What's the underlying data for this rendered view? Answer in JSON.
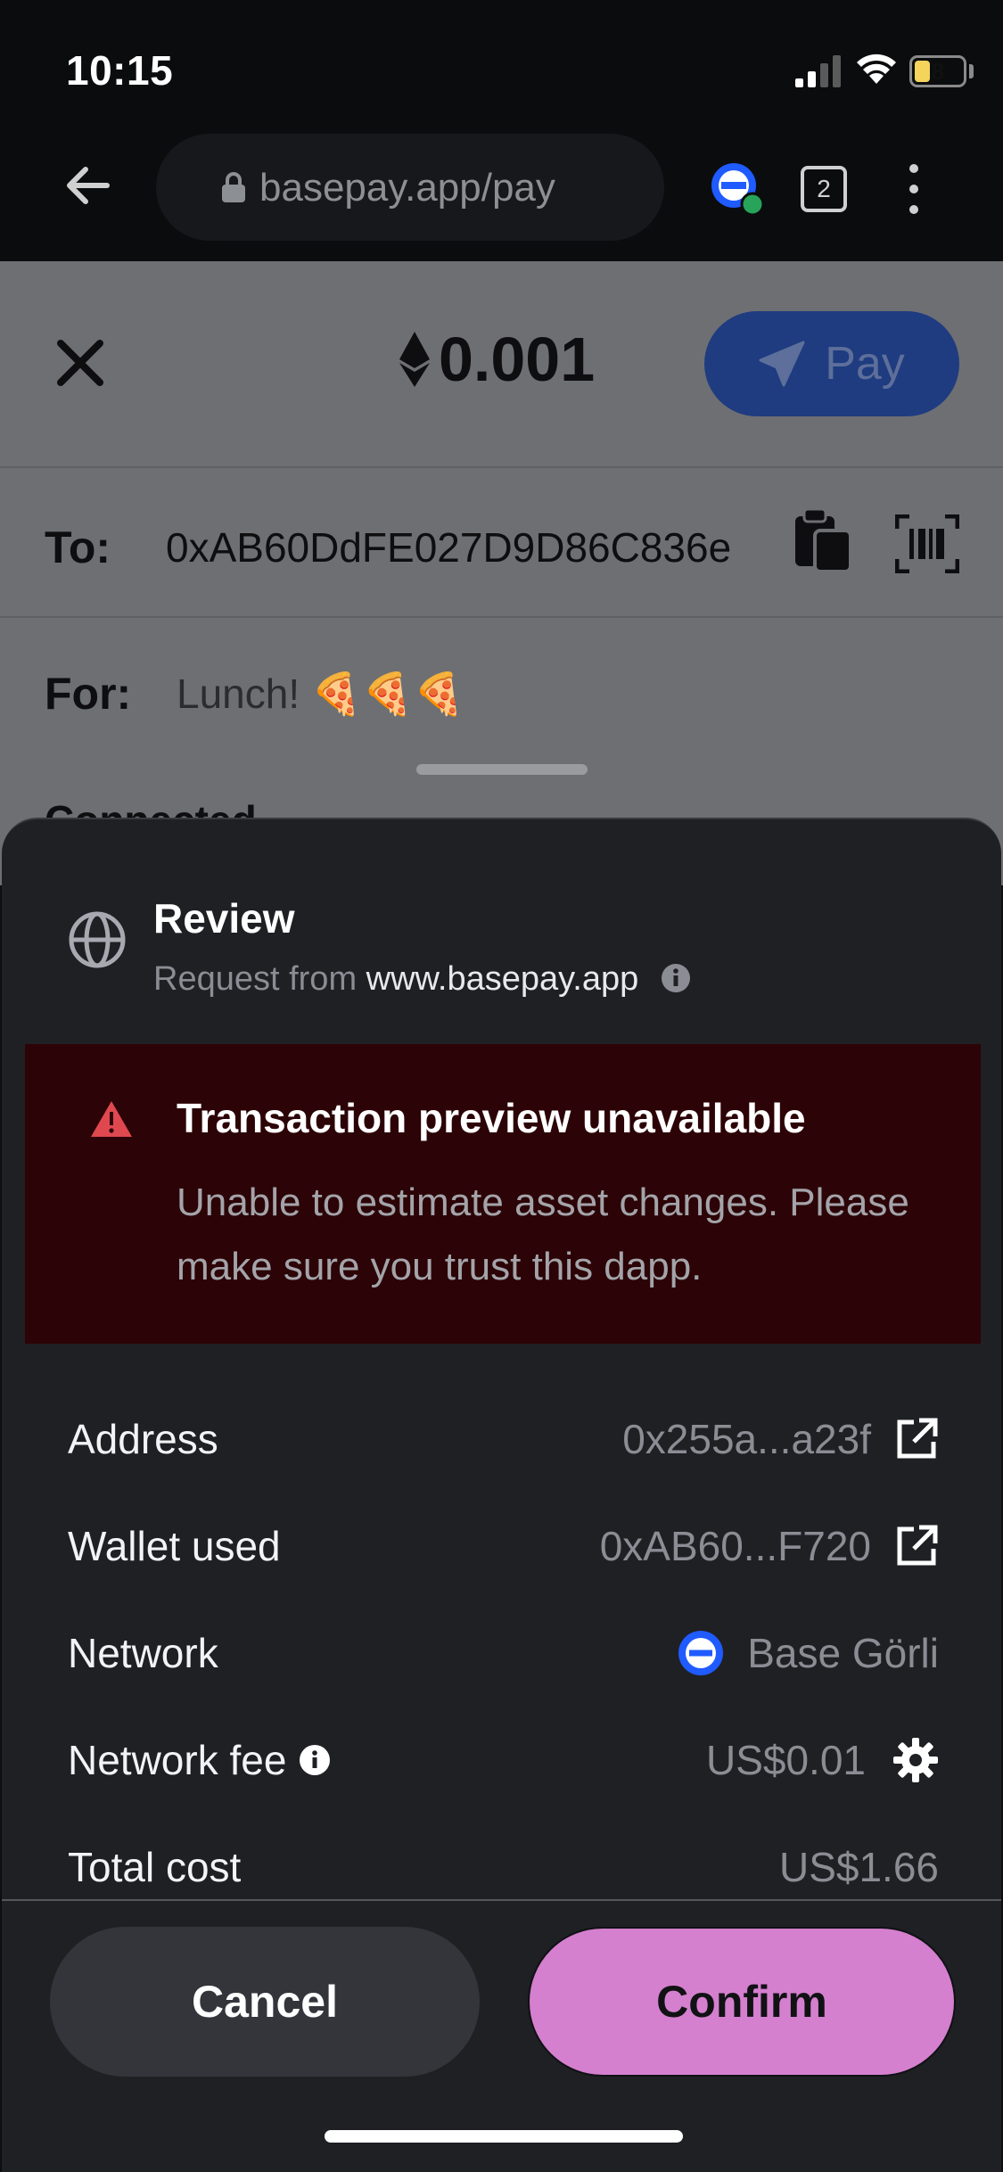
{
  "status_bar": {
    "time": "10:15",
    "battery": "8"
  },
  "browser": {
    "url": "basepay.app/pay",
    "tab_count": "2"
  },
  "payment": {
    "amount": "0.001",
    "pay_label": "Pay",
    "to_label": "To:",
    "to_address": "0xAB60DdFE027D9D86C836e",
    "for_label": "For:",
    "for_value": "Lunch! 🍕🍕🍕",
    "peek_text": "Connected"
  },
  "review": {
    "title": "Review",
    "request_prefix": "Request from",
    "request_domain": "www.basepay.app"
  },
  "warning": {
    "title": "Transaction preview unavailable",
    "body": "Unable to estimate asset changes. Please make sure you trust this dapp."
  },
  "details": {
    "address_label": "Address",
    "address_value": "0x255a...a23f",
    "wallet_label": "Wallet used",
    "wallet_value": "0xAB60...F720",
    "network_label": "Network",
    "network_value": "Base Görli",
    "fee_label": "Network fee",
    "fee_value": "US$0.01",
    "total_label": "Total cost",
    "total_value": "US$1.66"
  },
  "actions": {
    "cancel": "Cancel",
    "confirm": "Confirm"
  },
  "colors": {
    "confirm_bg": "#d57fcf",
    "warning_bg": "#2c0306",
    "network_blue": "#1f5bff",
    "pay_bg": "#1f3c80"
  }
}
